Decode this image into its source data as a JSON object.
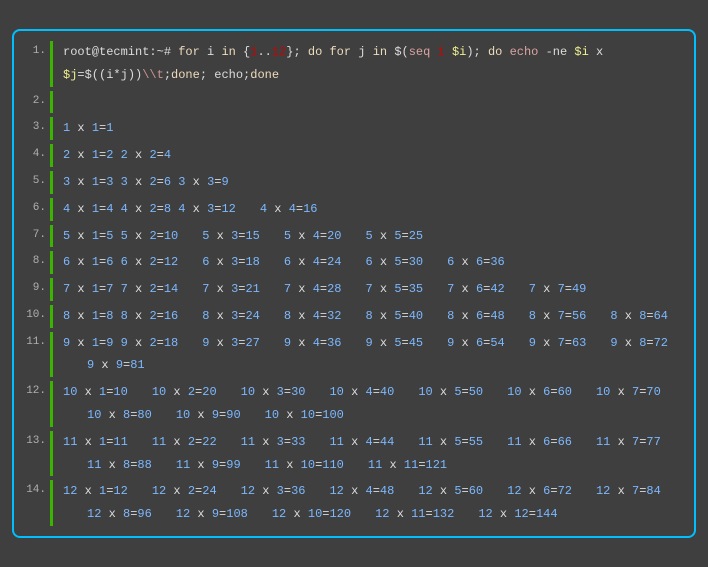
{
  "prefix": "root@tecmint:~# ",
  "kw_for": "for",
  "kw_in": "in",
  "kw_do": "do",
  "kw_done": "done",
  "seq_fn": "seq",
  "echo_fn": "echo",
  "range": "{1..12}",
  "var_i": "i",
  "var_j": "j",
  "dollar_i": "$i",
  "dollar_j": "$j",
  "one": "1",
  "dollar_open": "$(",
  "close_paren": ")",
  "semicolon": ";",
  "dollar_calc": "$((i*j))",
  "bs_t": "\\\\t",
  "echo_flag": "-ne ",
  "x_literal": " x ",
  "equals": "=",
  "space_echo": " echo;",
  "chart_data": {
    "type": "table",
    "title": "Multiplication table 1..12 (triangular)",
    "rows": [
      {
        "n": 1,
        "products": [
          1
        ]
      },
      {
        "n": 2,
        "products": [
          2,
          4
        ]
      },
      {
        "n": 3,
        "products": [
          3,
          6,
          9
        ]
      },
      {
        "n": 4,
        "products": [
          4,
          8,
          12,
          16
        ]
      },
      {
        "n": 5,
        "products": [
          5,
          10,
          15,
          20,
          25
        ]
      },
      {
        "n": 6,
        "products": [
          6,
          12,
          18,
          24,
          30,
          36
        ]
      },
      {
        "n": 7,
        "products": [
          7,
          14,
          21,
          28,
          35,
          42,
          49
        ]
      },
      {
        "n": 8,
        "products": [
          8,
          16,
          24,
          32,
          40,
          48,
          56,
          64
        ]
      },
      {
        "n": 9,
        "products": [
          9,
          18,
          27,
          36,
          45,
          54,
          63,
          72,
          81
        ]
      },
      {
        "n": 10,
        "products": [
          10,
          20,
          30,
          40,
          50,
          60,
          70,
          80,
          90,
          100
        ]
      },
      {
        "n": 11,
        "products": [
          11,
          22,
          33,
          44,
          55,
          66,
          77,
          88,
          99,
          110,
          121
        ]
      },
      {
        "n": 12,
        "products": [
          12,
          24,
          36,
          48,
          60,
          72,
          84,
          96,
          108,
          120,
          132,
          144
        ]
      }
    ]
  },
  "lineno": [
    "1.",
    "2.",
    "3.",
    "4.",
    "5.",
    "6.",
    "7.",
    "8.",
    "9.",
    "10.",
    "11.",
    "12.",
    "13.",
    "14."
  ]
}
